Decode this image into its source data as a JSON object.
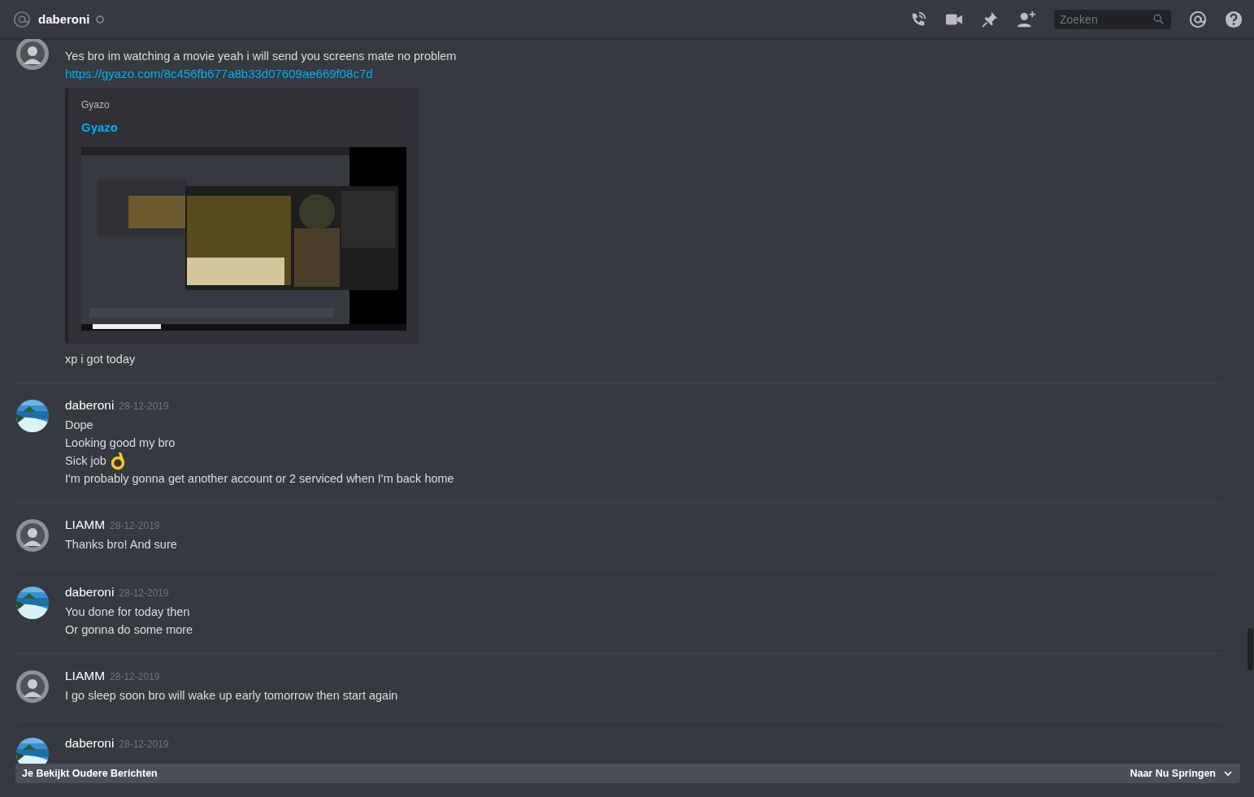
{
  "header": {
    "channel": "daberoni",
    "status": {
      "kind": "offline"
    },
    "search": {
      "placeholder": "Zoeken"
    }
  },
  "messages": [
    {
      "avatar": {
        "kind": "figure"
      },
      "lines": [
        {
          "text": "Yes bro im watching a movie yeah i will send you screens mate no problem",
          "kind": "plain"
        }
      ],
      "link": "https://gyazo.com/8c456fb677a8b33d07609ae669f08c7d",
      "embed": {
        "provider": "Gyazo",
        "title": "Gyazo",
        "kind": "picture"
      },
      "after": [
        {
          "text": "xp i got today",
          "kind": "plain"
        }
      ]
    },
    {
      "avatar": {
        "kind": "beach"
      },
      "author": "daberoni",
      "date": "28-12-2019",
      "lines": [
        {
          "text": "Dope",
          "kind": "plain"
        },
        {
          "text": "Looking good my bro",
          "kind": "plain"
        },
        {
          "text": "Sick job",
          "kind": "emoji"
        },
        {
          "text": "I'm probably gonna get another account or 2 serviced when I'm back home",
          "kind": "plain"
        }
      ]
    },
    {
      "avatar": {
        "kind": "figure"
      },
      "author": "LIAMM",
      "date": "28-12-2019",
      "lines": [
        {
          "text": "Thanks bro! And sure",
          "kind": "plain"
        }
      ]
    },
    {
      "avatar": {
        "kind": "beach"
      },
      "author": "daberoni",
      "date": "28-12-2019",
      "lines": [
        {
          "text": "You done for today then",
          "kind": "plain"
        },
        {
          "text": "Or gonna do some more",
          "kind": "plain"
        }
      ]
    },
    {
      "avatar": {
        "kind": "figure"
      },
      "author": "LIAMM",
      "date": "28-12-2019",
      "lines": [
        {
          "text": "I go sleep soon bro will wake up early tomorrow then start again",
          "kind": "plain"
        }
      ]
    },
    {
      "avatar": {
        "kind": "beach"
      },
      "author": "daberoni",
      "date": "28-12-2019"
    }
  ],
  "banner": {
    "text": "Je Bekijkt Oudere Berichten",
    "action": "Naar Nu Springen"
  }
}
